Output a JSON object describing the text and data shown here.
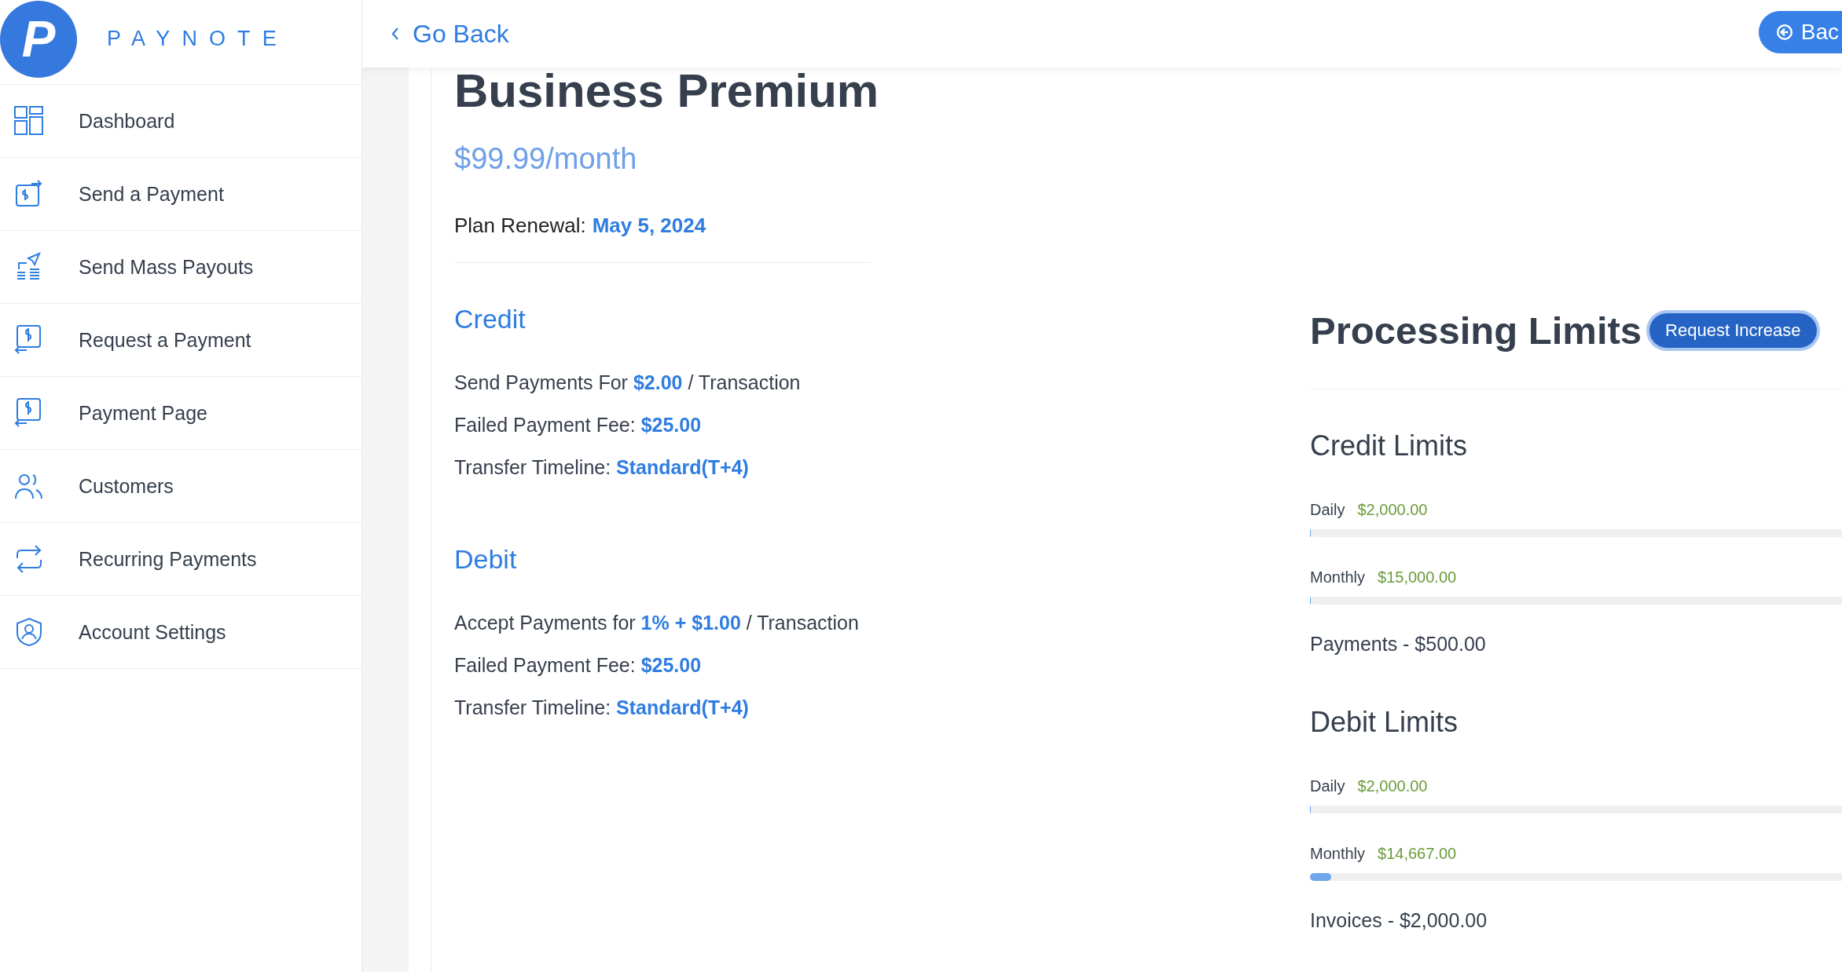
{
  "sidebar": {
    "logo_letter": "P",
    "brand": "PAYNOTE",
    "items": [
      {
        "label": "Dashboard"
      },
      {
        "label": "Send a Payment"
      },
      {
        "label": "Send Mass Payouts"
      },
      {
        "label": "Request a Payment"
      },
      {
        "label": "Payment Page"
      },
      {
        "label": "Customers"
      },
      {
        "label": "Recurring Payments"
      },
      {
        "label": "Account Settings"
      }
    ]
  },
  "header": {
    "back_link": "Go Back",
    "back_button": "Bac"
  },
  "plan": {
    "title": "Business Premium",
    "price": "$99.99/month",
    "renewal_label": "Plan Renewal:",
    "renewal_date": "May 5, 2024",
    "sections": [
      {
        "heading": "Credit",
        "lines": [
          "Send Payments For **$2.00** / Transaction",
          "Failed Payment Fee: **$25.00**",
          "Transfer Timeline: **Standard(T+4)**"
        ]
      },
      {
        "heading": "Debit",
        "lines": [
          "Accept Payments for **1% + $1.00** / Transaction",
          "Failed Payment Fee: **$25.00**",
          "Transfer Timeline: **Standard(T+4)**"
        ]
      }
    ]
  },
  "limits": {
    "title": "Processing Limits",
    "button": "Request Increase",
    "groups": [
      {
        "heading": "Credit Limits",
        "rows": [
          {
            "label": "Daily",
            "amount": "$2,000.00",
            "level": 0
          },
          {
            "label": "Monthly",
            "amount": "$15,000.00",
            "level": 0
          }
        ],
        "total": "Payments - $500.00"
      },
      {
        "heading": "Debit Limits",
        "rows": [
          {
            "label": "Daily",
            "amount": "$2,000.00",
            "level": 0
          },
          {
            "label": "Monthly",
            "amount": "$14,667.00",
            "level": 0.03
          }
        ],
        "total": "Invoices - $2,000.00"
      }
    ]
  }
}
